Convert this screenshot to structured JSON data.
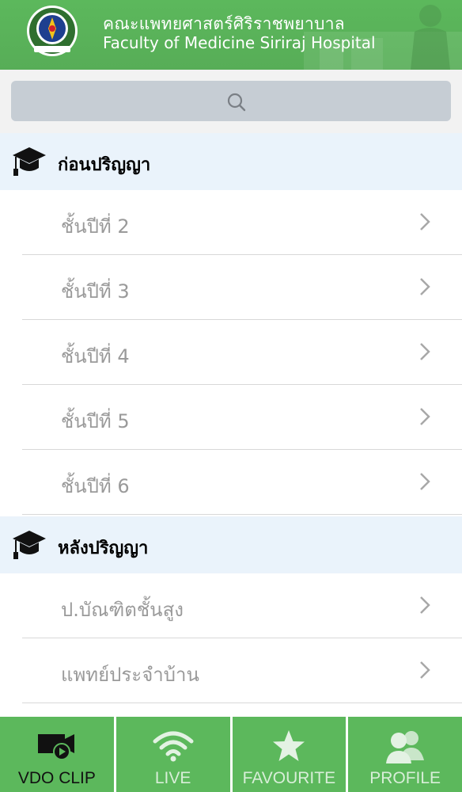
{
  "header": {
    "title_th": "คณะแพทยศาสตร์ศิริราชพยาบาล",
    "title_en": "Faculty of Medicine Siriraj Hospital"
  },
  "search": {
    "placeholder": ""
  },
  "sections": [
    {
      "label": "ก่อนปริญญา",
      "items": [
        {
          "label": "ชั้นปีที่ 2"
        },
        {
          "label": "ชั้นปีที่ 3"
        },
        {
          "label": "ชั้นปีที่ 4"
        },
        {
          "label": "ชั้นปีที่ 5"
        },
        {
          "label": "ชั้นปีที่ 6"
        }
      ]
    },
    {
      "label": "หลังปริญญา",
      "items": [
        {
          "label": "ป.บัณฑิตชั้นสูง"
        },
        {
          "label": "แพทย์ประจำบ้าน"
        }
      ]
    }
  ],
  "tabs": [
    {
      "label": "VDO CLIP",
      "icon": "video-camera-icon",
      "active": true
    },
    {
      "label": "LIVE",
      "icon": "wifi-icon",
      "active": false
    },
    {
      "label": "FAVOURITE",
      "icon": "star-icon",
      "active": false
    },
    {
      "label": "PROFILE",
      "icon": "profile-users-icon",
      "active": false
    }
  ],
  "colors": {
    "brand_green": "#5cb85c",
    "section_bg": "#eaf3fb",
    "item_text": "#9a9a9a"
  }
}
